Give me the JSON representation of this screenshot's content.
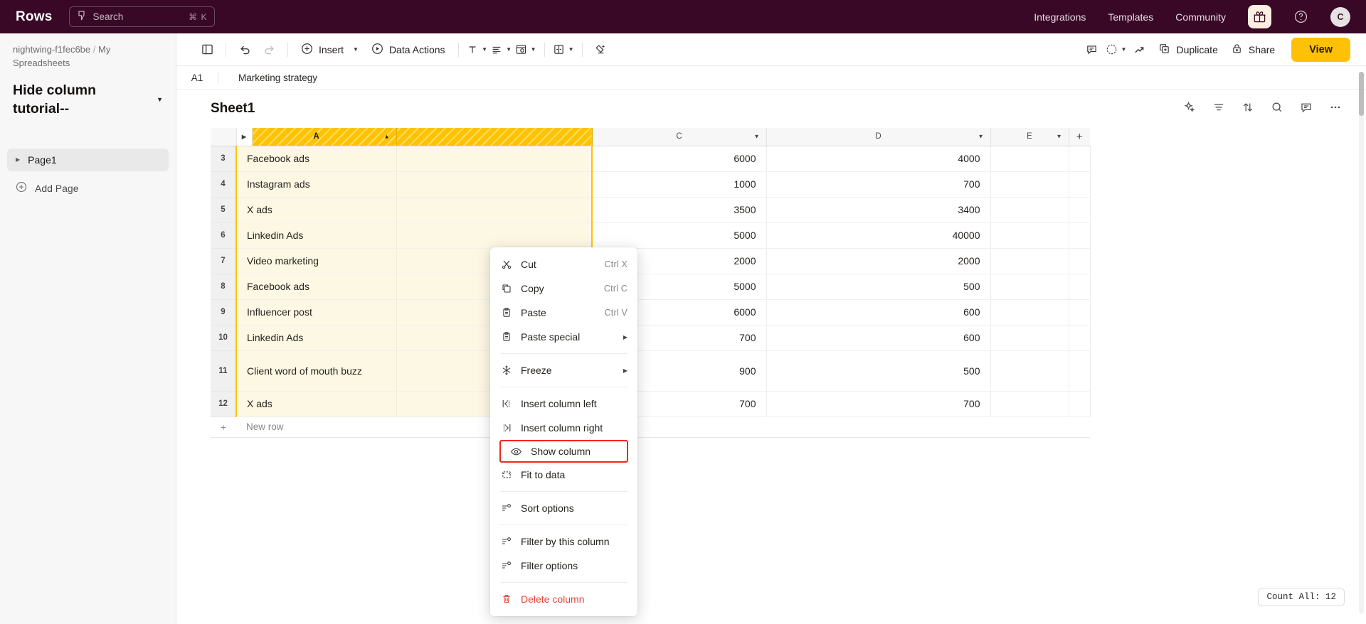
{
  "topbar": {
    "brand": "Rows",
    "search": {
      "placeholder": "Search",
      "shortcut": "⌘ K",
      "icon": "lightning-icon"
    },
    "nav": [
      {
        "label": "Integrations"
      },
      {
        "label": "Templates"
      },
      {
        "label": "Community"
      }
    ],
    "gift_icon": "gift-icon",
    "help_icon": "help-circle-icon",
    "avatar_initial": "C"
  },
  "sidebar": {
    "breadcrumb_workspace": "nightwing-f1fec6be",
    "breadcrumb_sep": "/",
    "breadcrumb_folder": "My Spreadsheets",
    "project_title": "Hide column tutorial--",
    "pages": [
      {
        "label": "Page1"
      }
    ],
    "add_page_label": "Add Page"
  },
  "toolbar": {
    "panel_icon": "sidebar-panel-icon",
    "undo_icon": "undo-icon",
    "redo_icon": "redo-icon",
    "insert_label": "Insert",
    "data_actions_label": "Data Actions",
    "text_format_icon": "text-format-icon",
    "align_icon": "align-icon",
    "cell_style_icon": "cell-style-icon",
    "merge_icon": "merge-cells-icon",
    "clear_format_icon": "clear-format-icon",
    "comment_icon": "comment-icon",
    "history_icon": "version-history-icon",
    "trend_icon": "trend-icon",
    "duplicate_label": "Duplicate",
    "share_label": "Share",
    "view_label": "View"
  },
  "formulabar": {
    "cell_ref": "A1",
    "value": "Marketing strategy"
  },
  "sheet": {
    "title": "Sheet1",
    "icons": [
      {
        "name": "ai-sparkle-icon"
      },
      {
        "name": "filter-icon"
      },
      {
        "name": "sort-icon"
      },
      {
        "name": "search-icon"
      },
      {
        "name": "comment-icon"
      },
      {
        "name": "more-options-icon"
      }
    ]
  },
  "grid": {
    "columns": [
      {
        "id": "A",
        "label": "A",
        "selected": true,
        "hidden_expander": true
      },
      {
        "id": "B",
        "label": "",
        "selected": true,
        "covered_by_menu": true
      },
      {
        "id": "C",
        "label": "C",
        "selected": false
      },
      {
        "id": "D",
        "label": "D",
        "selected": false
      },
      {
        "id": "E",
        "label": "E",
        "selected": false
      }
    ],
    "add_column_label": "+",
    "rows": [
      {
        "n": "3",
        "A": "Facebook ads",
        "C": "6000",
        "D": "4000",
        "E": ""
      },
      {
        "n": "4",
        "A": "Instagram ads",
        "C": "1000",
        "D": "700",
        "E": ""
      },
      {
        "n": "5",
        "A": "X ads",
        "C": "3500",
        "D": "3400",
        "E": ""
      },
      {
        "n": "6",
        "A": "Linkedin Ads",
        "C": "5000",
        "D": "40000",
        "E": ""
      },
      {
        "n": "7",
        "A": "Video marketing",
        "C": "2000",
        "D": "2000",
        "E": ""
      },
      {
        "n": "8",
        "A": "Facebook ads",
        "C": "5000",
        "D": "500",
        "E": ""
      },
      {
        "n": "9",
        "A": "Influencer post",
        "C": "6000",
        "D": "600",
        "E": ""
      },
      {
        "n": "10",
        "A": "Linkedin Ads",
        "C": "700",
        "D": "600",
        "E": ""
      },
      {
        "n": "11",
        "A": "Client word of mouth buzz",
        "C": "900",
        "D": "500",
        "E": "",
        "tall": true
      },
      {
        "n": "12",
        "A": "X ads",
        "C": "700",
        "D": "700",
        "E": ""
      }
    ],
    "new_row_label": "New row",
    "new_row_plus": "+"
  },
  "context_menu": {
    "items": [
      {
        "icon": "scissors-icon",
        "label": "Cut",
        "shortcut": "Ctrl X"
      },
      {
        "icon": "copy-icon",
        "label": "Copy",
        "shortcut": "Ctrl C"
      },
      {
        "icon": "clipboard-icon",
        "label": "Paste",
        "shortcut": "Ctrl V"
      },
      {
        "icon": "clipboard-special-icon",
        "label": "Paste special",
        "submenu": true
      },
      {
        "divider": true
      },
      {
        "icon": "snowflake-icon",
        "label": "Freeze",
        "submenu": true
      },
      {
        "divider": true
      },
      {
        "icon": "insert-column-left-icon",
        "label": "Insert column left"
      },
      {
        "icon": "insert-column-right-icon",
        "label": "Insert column right"
      },
      {
        "icon": "eye-icon",
        "label": "Show column",
        "highlighted": true
      },
      {
        "icon": "fit-to-data-icon",
        "label": "Fit to data"
      },
      {
        "divider": true
      },
      {
        "icon": "sort-options-icon",
        "label": "Sort options"
      },
      {
        "divider": true
      },
      {
        "icon": "filter-column-icon",
        "label": "Filter by this column"
      },
      {
        "icon": "filter-options-icon",
        "label": "Filter options"
      },
      {
        "divider": true
      },
      {
        "icon": "trash-icon",
        "label": "Delete column",
        "danger": true
      }
    ]
  },
  "status": {
    "count_label": "Count All: 12"
  },
  "colors": {
    "topbar_bg": "#380826",
    "accent_yellow": "#ffc107",
    "selection_yellow": "#fdc300",
    "highlight_red": "#f5261a",
    "danger_red": "#e8443a"
  }
}
